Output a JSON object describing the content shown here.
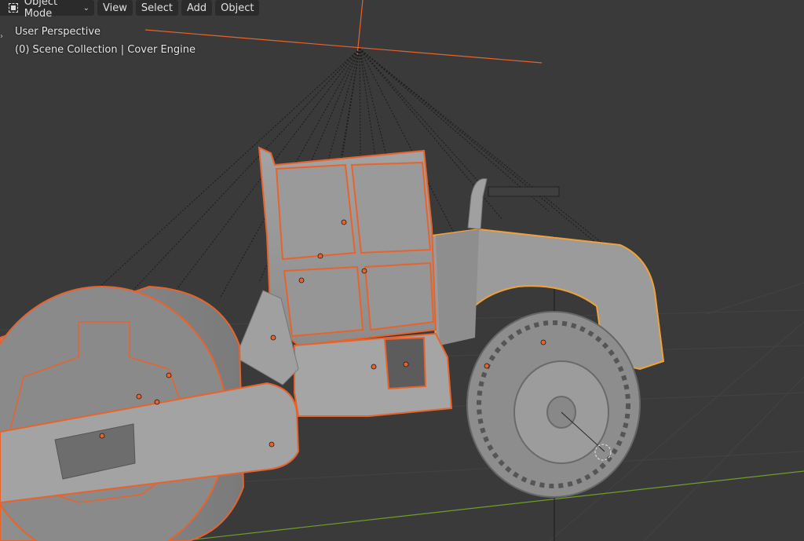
{
  "header": {
    "mode_label": "Object Mode",
    "menu": [
      "View",
      "Select",
      "Add",
      "Object"
    ]
  },
  "overlay": {
    "view_name": "User Perspective",
    "collection_info": "(0) Scene Collection | Cover Engine"
  },
  "icons": {
    "mode": "object-mode-icon",
    "dropdown": "chevron-down-icon",
    "sidebar_toggle": "chevron-right-icon"
  },
  "colors": {
    "viewport_bg": "#3a3a3a",
    "selection_outline": "#e8632c",
    "active_outline": "#f0a23a",
    "x_axis": "#b04848",
    "y_axis": "#6f9e2d",
    "mesh": "#9a9a9a"
  }
}
